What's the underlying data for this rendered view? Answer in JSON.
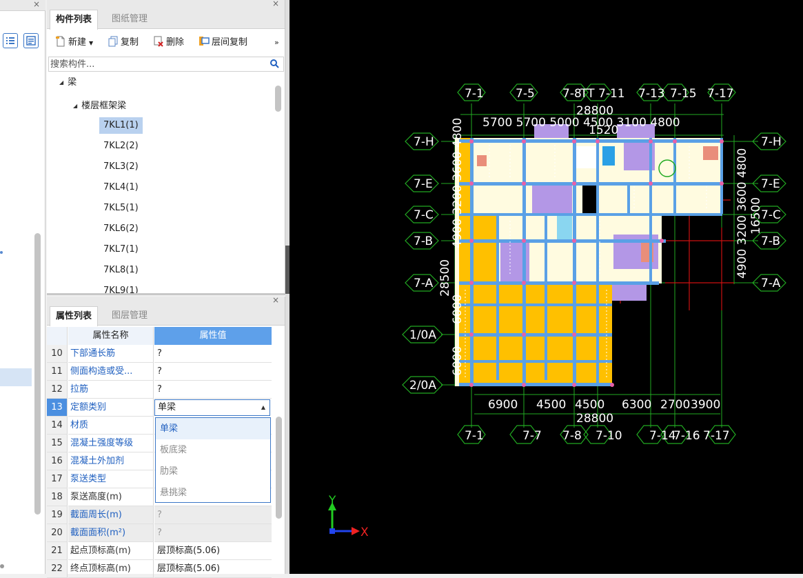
{
  "left_strip": {
    "close": "×"
  },
  "component_list": {
    "close": "×",
    "tabs": [
      "构件列表",
      "图纸管理"
    ],
    "toolbar": {
      "new": "新建",
      "copy": "复制",
      "delete": "删除",
      "floor_copy": "层间复制",
      "more": "»"
    },
    "search_placeholder": "搜索构件...",
    "tree": {
      "root": "梁",
      "group": "楼层框架梁",
      "items": [
        "7KL1(1)",
        "7KL2(2)",
        "7KL3(2)",
        "7KL4(1)",
        "7KL5(1)",
        "7KL6(2)",
        "7KL7(1)",
        "7KL8(1)",
        "7KL9(1)"
      ]
    }
  },
  "properties": {
    "close": "×",
    "tabs": [
      "属性列表",
      "图层管理"
    ],
    "col_name": "属性名称",
    "col_value": "属性值",
    "rows": [
      {
        "num": "10",
        "name": "下部通长筋",
        "value": "?"
      },
      {
        "num": "11",
        "name": "侧面构造或受...",
        "value": "?"
      },
      {
        "num": "12",
        "name": "拉筋",
        "value": "?"
      },
      {
        "num": "13",
        "name": "定额类别",
        "value": "单梁"
      },
      {
        "num": "14",
        "name": "材质",
        "value": ""
      },
      {
        "num": "15",
        "name": "混凝土强度等级",
        "value": ""
      },
      {
        "num": "16",
        "name": "混凝土外加剂",
        "value": ""
      },
      {
        "num": "17",
        "name": "泵送类型",
        "value": ""
      },
      {
        "num": "18",
        "name": "泵送高度(m)",
        "value": ""
      },
      {
        "num": "19",
        "name": "截面周长(m)",
        "value": "?"
      },
      {
        "num": "20",
        "name": "截面面积(m²)",
        "value": "?"
      },
      {
        "num": "21",
        "name": "起点顶标高(m)",
        "value": "层顶标高(5.06)"
      },
      {
        "num": "22",
        "name": "终点顶标高(m)",
        "value": "层顶标高(5.06)"
      }
    ],
    "dropdown_options": [
      "单梁",
      "板底梁",
      "肋梁",
      "悬挑梁"
    ]
  },
  "canvas": {
    "top_axes": [
      "7-1",
      "7-5",
      "7-8",
      "7-11",
      "7-13",
      "7-15",
      "7-17"
    ],
    "top_axes_extra": "TT",
    "top_total": "28800",
    "top_dims": "5700  5700  5000 4500 3100 4800",
    "top_overlap": "1520",
    "bottom_axes": [
      "7-1",
      "7-7",
      "7-8",
      "7-10",
      "7-14",
      "7-16",
      "7-17"
    ],
    "bottom_dims": [
      "6900",
      "4500",
      "4500",
      "6300",
      "2700",
      "3900"
    ],
    "bottom_total": "28800",
    "left_axes": [
      "7-H",
      "7-E",
      "7-C",
      "7-B",
      "7-A",
      "1/0A",
      "2/0A"
    ],
    "right_axes": [
      "7-H",
      "7-E",
      "7-C",
      "7-B",
      "7-A"
    ],
    "left_dims_vertical": "4900 3200 3600 4800",
    "left_total": "28500",
    "left_dims_lower": [
      "6000",
      "6000"
    ],
    "right_dims_vertical": "4900 3200 3600 4800",
    "right_total": "16500",
    "axis_x": "X",
    "axis_y": "Y",
    "colors": {
      "orange": "#ffc000",
      "purple": "#b397e6",
      "cream": "#fffbe0",
      "beam": "#5aa0e6",
      "grid": "#22aa22",
      "red": "#cc1111"
    }
  }
}
